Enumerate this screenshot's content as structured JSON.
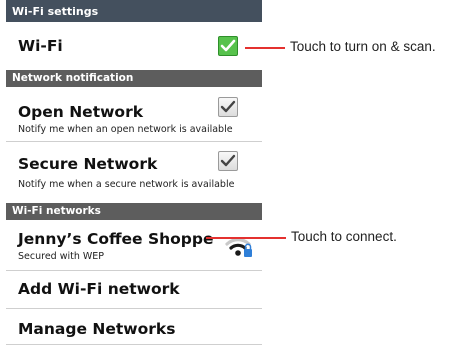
{
  "header": {
    "title": "Wi-Fi settings"
  },
  "wifi_row": {
    "title": "Wi-Fi",
    "checked": true
  },
  "section_notification": {
    "label": "Network notification"
  },
  "open_network": {
    "title": "Open Network",
    "subtitle": "Notify me when an open network is available",
    "checked": true
  },
  "secure_network": {
    "title": "Secure Network",
    "subtitle": "Notify me when a secure network is available",
    "checked": true
  },
  "section_networks": {
    "label": "Wi-Fi networks"
  },
  "network": {
    "title": "Jenny’s Coffee Shoppe",
    "subtitle": "Secured with WEP",
    "icon": "wifi-locked-icon"
  },
  "add_network": {
    "title": "Add Wi-Fi network"
  },
  "manage_networks": {
    "title": "Manage Networks"
  },
  "callouts": {
    "toggle": "Touch to turn on & scan.",
    "connect": "Touch to connect."
  },
  "colors": {
    "header_bg": "#44505e",
    "section_bg": "#5d5d5d",
    "checkbox_on": "#57c24c",
    "callout_line": "#e4312f",
    "lock_badge": "#2f7fd8"
  }
}
